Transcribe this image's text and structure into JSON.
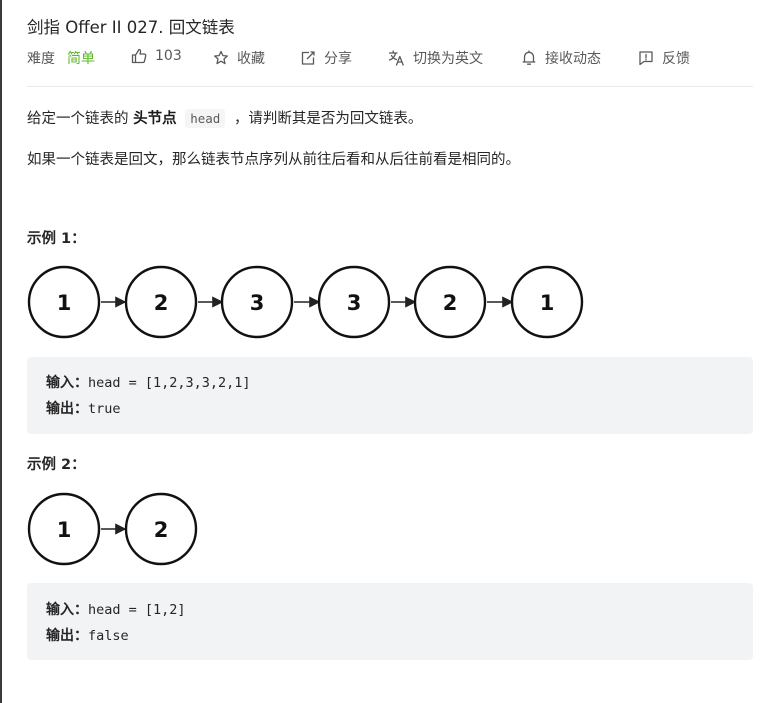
{
  "problem": {
    "title": "剑指 Offer II 027. 回文链表"
  },
  "meta": {
    "difficulty_label": "难度",
    "difficulty_value": "简单",
    "likes": "103",
    "favorite_label": "收藏",
    "share_label": "分享",
    "switch_lang_label": "切换为英文",
    "notify_label": "接收动态",
    "feedback_label": "反馈",
    "colors": {
      "easy": "#5ab726",
      "text": "#262626",
      "muted": "#595959"
    }
  },
  "description": {
    "p1_pre": "给定一个链表的",
    "p1_bold": "头节点",
    "p1_code": "head",
    "p1_post": "，请判断其是否为回文链表。",
    "p2": "如果一个链表是回文，那么链表节点序列从前往后看和从后往前看是相同的。"
  },
  "examples": [
    {
      "title": "示例 1：",
      "nodes": [
        "1",
        "2",
        "3",
        "3",
        "2",
        "1"
      ],
      "input_label": "输入：",
      "input_value": "head = [1,2,3,3,2,1]",
      "output_label": "输出：",
      "output_value": "true"
    },
    {
      "title": "示例 2：",
      "nodes": [
        "1",
        "2"
      ],
      "input_label": "输入：",
      "input_value": "head = [1,2]",
      "output_label": "输出：",
      "output_value": "false"
    }
  ]
}
